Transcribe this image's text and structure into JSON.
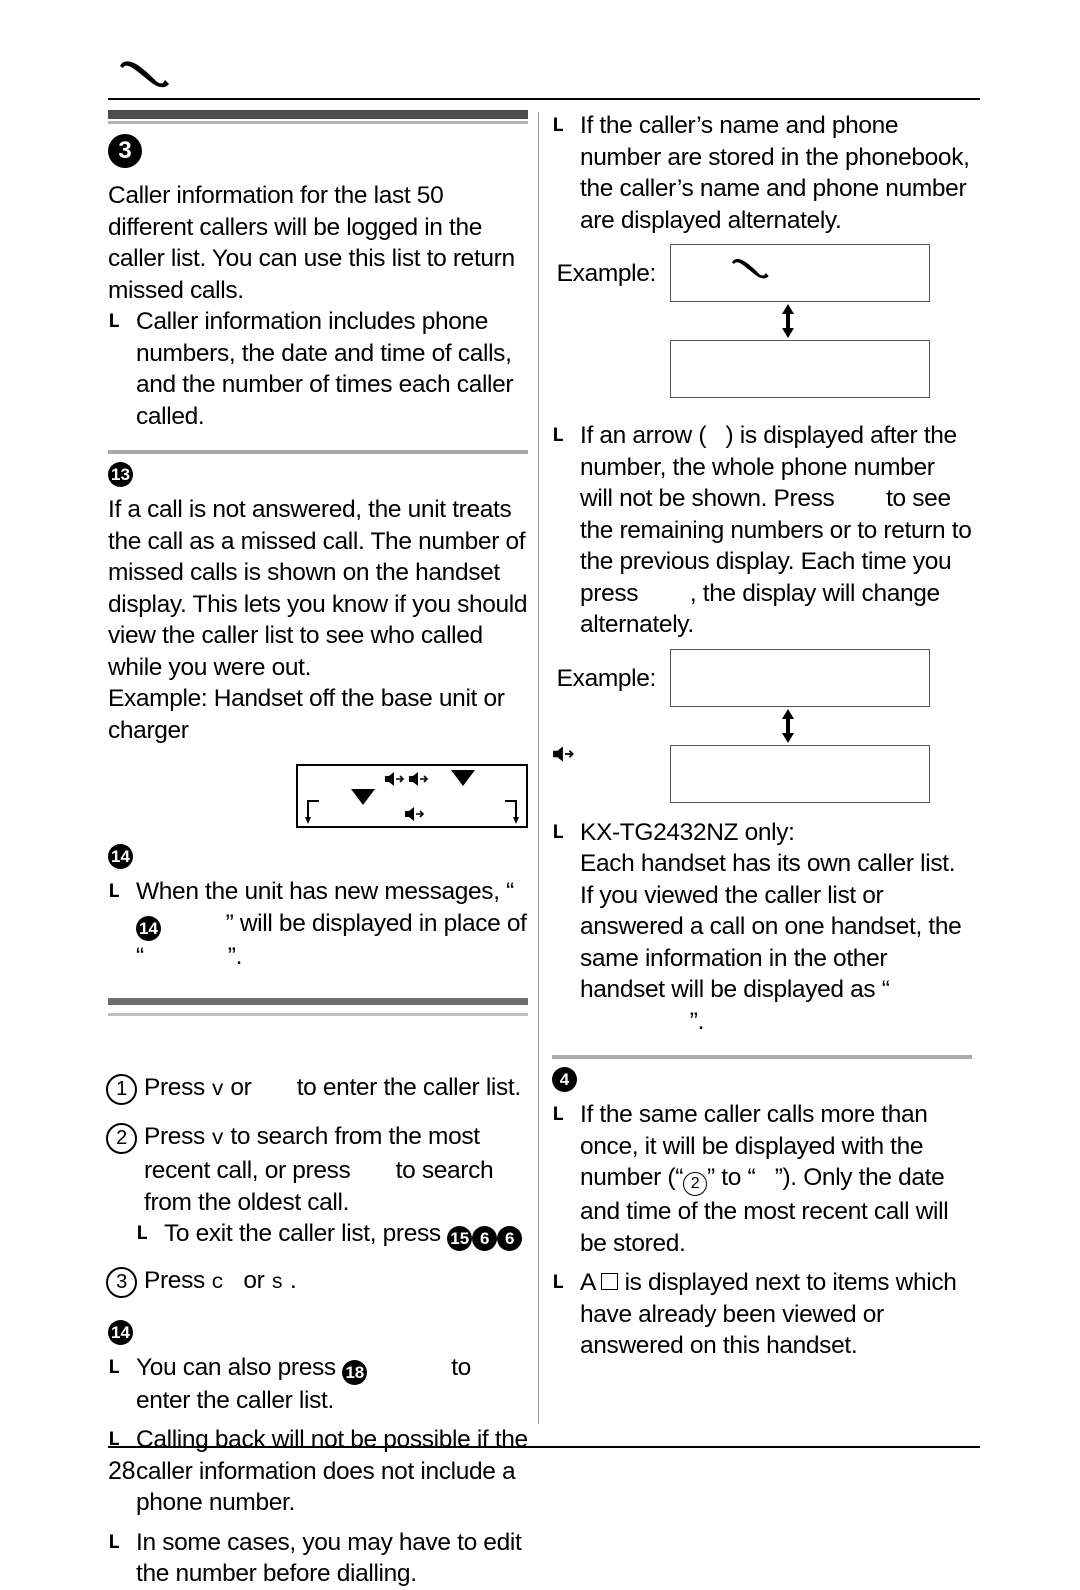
{
  "page": {
    "number": "28",
    "header_icon": "telephone-handset-icon"
  },
  "left_column": {
    "section_caller_list": {
      "marker": "3",
      "paragraphs": [
        "Caller information for the last 50 different callers will be logged in the caller list. You can use this list to return missed calls."
      ],
      "bullets": [
        "Caller information includes phone numbers, the date and time of calls, and the number of times each caller called."
      ]
    },
    "section_missed_call": {
      "marker": "13",
      "paragraphs": [
        "If a call is not answered, the unit treats the call as a missed call. The number of missed calls is shown on the handset display. This lets you know if you should view the caller list to see who called while you were out.",
        "Example: Handset off the base unit or charger"
      ],
      "lcd_icons": [
        "speaker-icon",
        "speaker-icon",
        "down-triangle-icon",
        "down-triangle-icon",
        "speaker-icon",
        "corner-down-arrow-left-icon",
        "corner-down-arrow-right-icon"
      ]
    },
    "section_new_messages": {
      "marker": "14",
      "bullets": [
        {
          "pre": "When the unit has new messages, “",
          "inline_marker": "14",
          "mid": "” will be displayed in place of “",
          "post": "”."
        }
      ]
    },
    "procedure": {
      "steps": [
        {
          "number": "1",
          "pre": "Press ",
          "key1": "v",
          "mid": " or ",
          "post": " to enter the caller list."
        },
        {
          "number": "2",
          "pre": "Press ",
          "key1": "v",
          "mid": " to search from the most recent call, or press ",
          "post": " to search from the oldest call.",
          "substep": {
            "pre": "To exit the caller list, press ",
            "markers": [
              "15",
              "6",
              "6"
            ]
          }
        },
        {
          "number": "3",
          "pre": "Press ",
          "key1": "c",
          "mid": " or ",
          "key2": "s",
          "post": " ."
        }
      ]
    },
    "section_note": {
      "marker": "14",
      "bullets": [
        {
          "pre": "You can also press ",
          "inline_marker": "18",
          "post": " to enter the caller list."
        },
        {
          "text": "Calling back will not be possible if the caller information does not include a phone number."
        },
        {
          "text": "In some cases, you may have to edit the number before dialling."
        }
      ]
    }
  },
  "right_column": {
    "bullet_phonebook": "If the caller’s name and phone number are stored in the phonebook, the caller’s name and phone number are displayed alternately.",
    "example_1": {
      "label": "Example:",
      "box_top_icon": "telephone-handset-icon",
      "arrow_icon": "double-vertical-arrow-icon",
      "box_top_text": "",
      "box_bottom_text": ""
    },
    "bullet_arrow": {
      "pre": "If an arrow (",
      "mid": ") is displayed after the number, the whole phone number will not be shown. Press ",
      "mid2": " to see the remaining numbers or to return to the previous display. Each time you press ",
      "post": ", the display will change alternately."
    },
    "example_2": {
      "label": "Example:",
      "arrow_icon": "double-vertical-arrow-icon",
      "side_icon": "speaker-icon",
      "box_top_text": "",
      "box_bottom_text": ""
    },
    "bullet_model": {
      "heading": "KX-TG2432NZ only:",
      "pre": "Each handset has its own caller list. If you viewed the caller list or answered a call on one handset, the same information in the other handset will be displayed as “",
      "post": "”."
    },
    "section_repeat": {
      "marker": "4",
      "bullets": [
        {
          "pre": "If the same caller calls more than once, it will be displayed with the number (“",
          "circled": "2",
          "mid": "” to “",
          "post": "”). Only the date and time of the most recent call will be stored."
        },
        {
          "pre": "A ",
          "square_icon": "empty-square-icon",
          "post": " is displayed next to items which have already been viewed or answered on this handset."
        }
      ]
    }
  }
}
